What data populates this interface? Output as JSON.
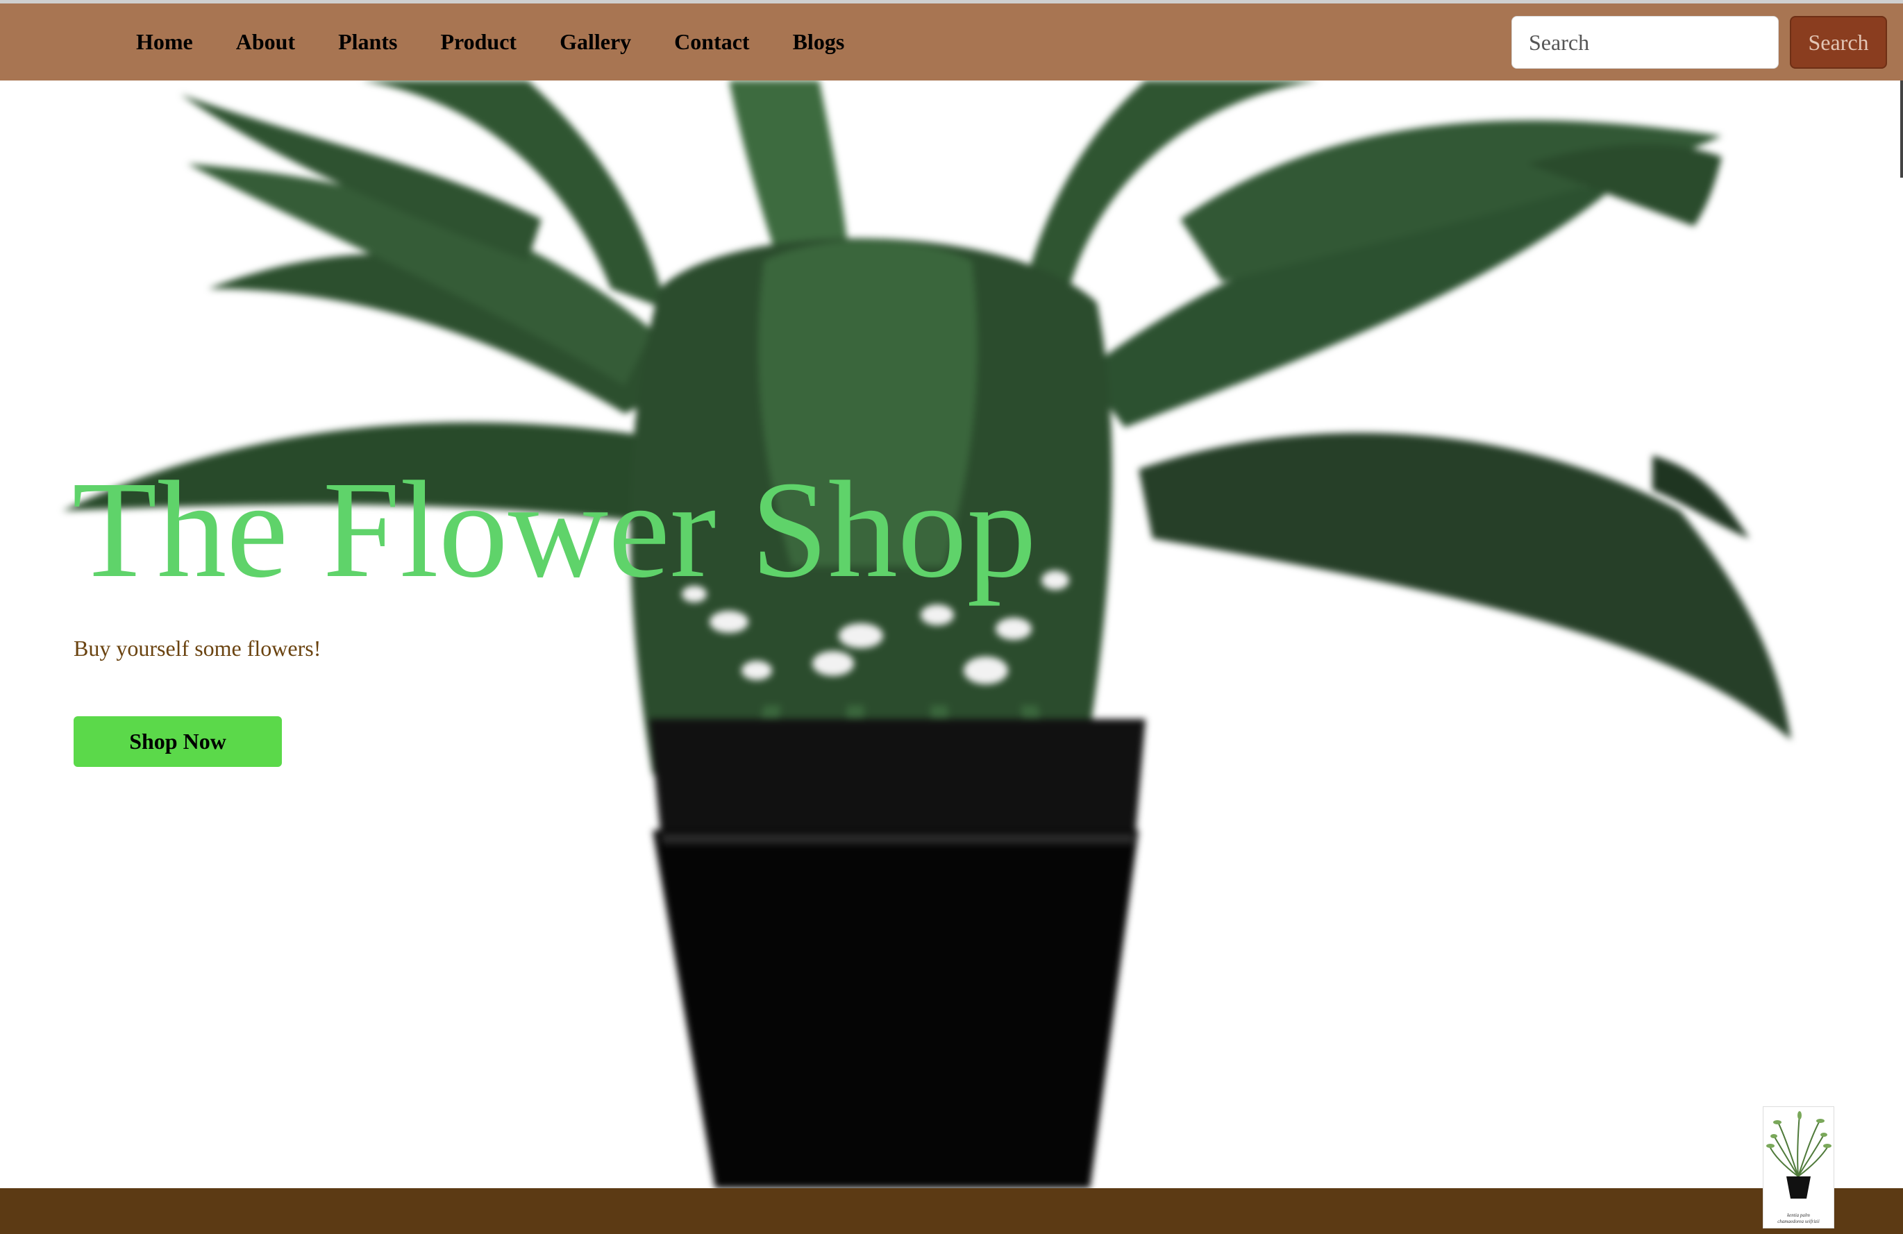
{
  "nav": {
    "links": [
      "Home",
      "About",
      "Plants",
      "Product",
      "Gallery",
      "Contact",
      "Blogs"
    ],
    "search_placeholder": "Search",
    "search_button": "Search"
  },
  "hero": {
    "title": "The Flower Shop",
    "subtitle": "Buy yourself some flowers!",
    "cta": "Shop Now",
    "background_image": "potted-plant"
  },
  "footer_thumbnail": {
    "image": "palm-plant-icon",
    "caption_line1": "kentia palm",
    "caption_line2": "chamaedorea seifrizii"
  },
  "colors": {
    "navbar": "#a87552",
    "search_button": "#8a3d1f",
    "title": "#5fd36a",
    "subtitle": "#6a4310",
    "cta": "#5bd94a",
    "footer": "#5c3a14"
  }
}
